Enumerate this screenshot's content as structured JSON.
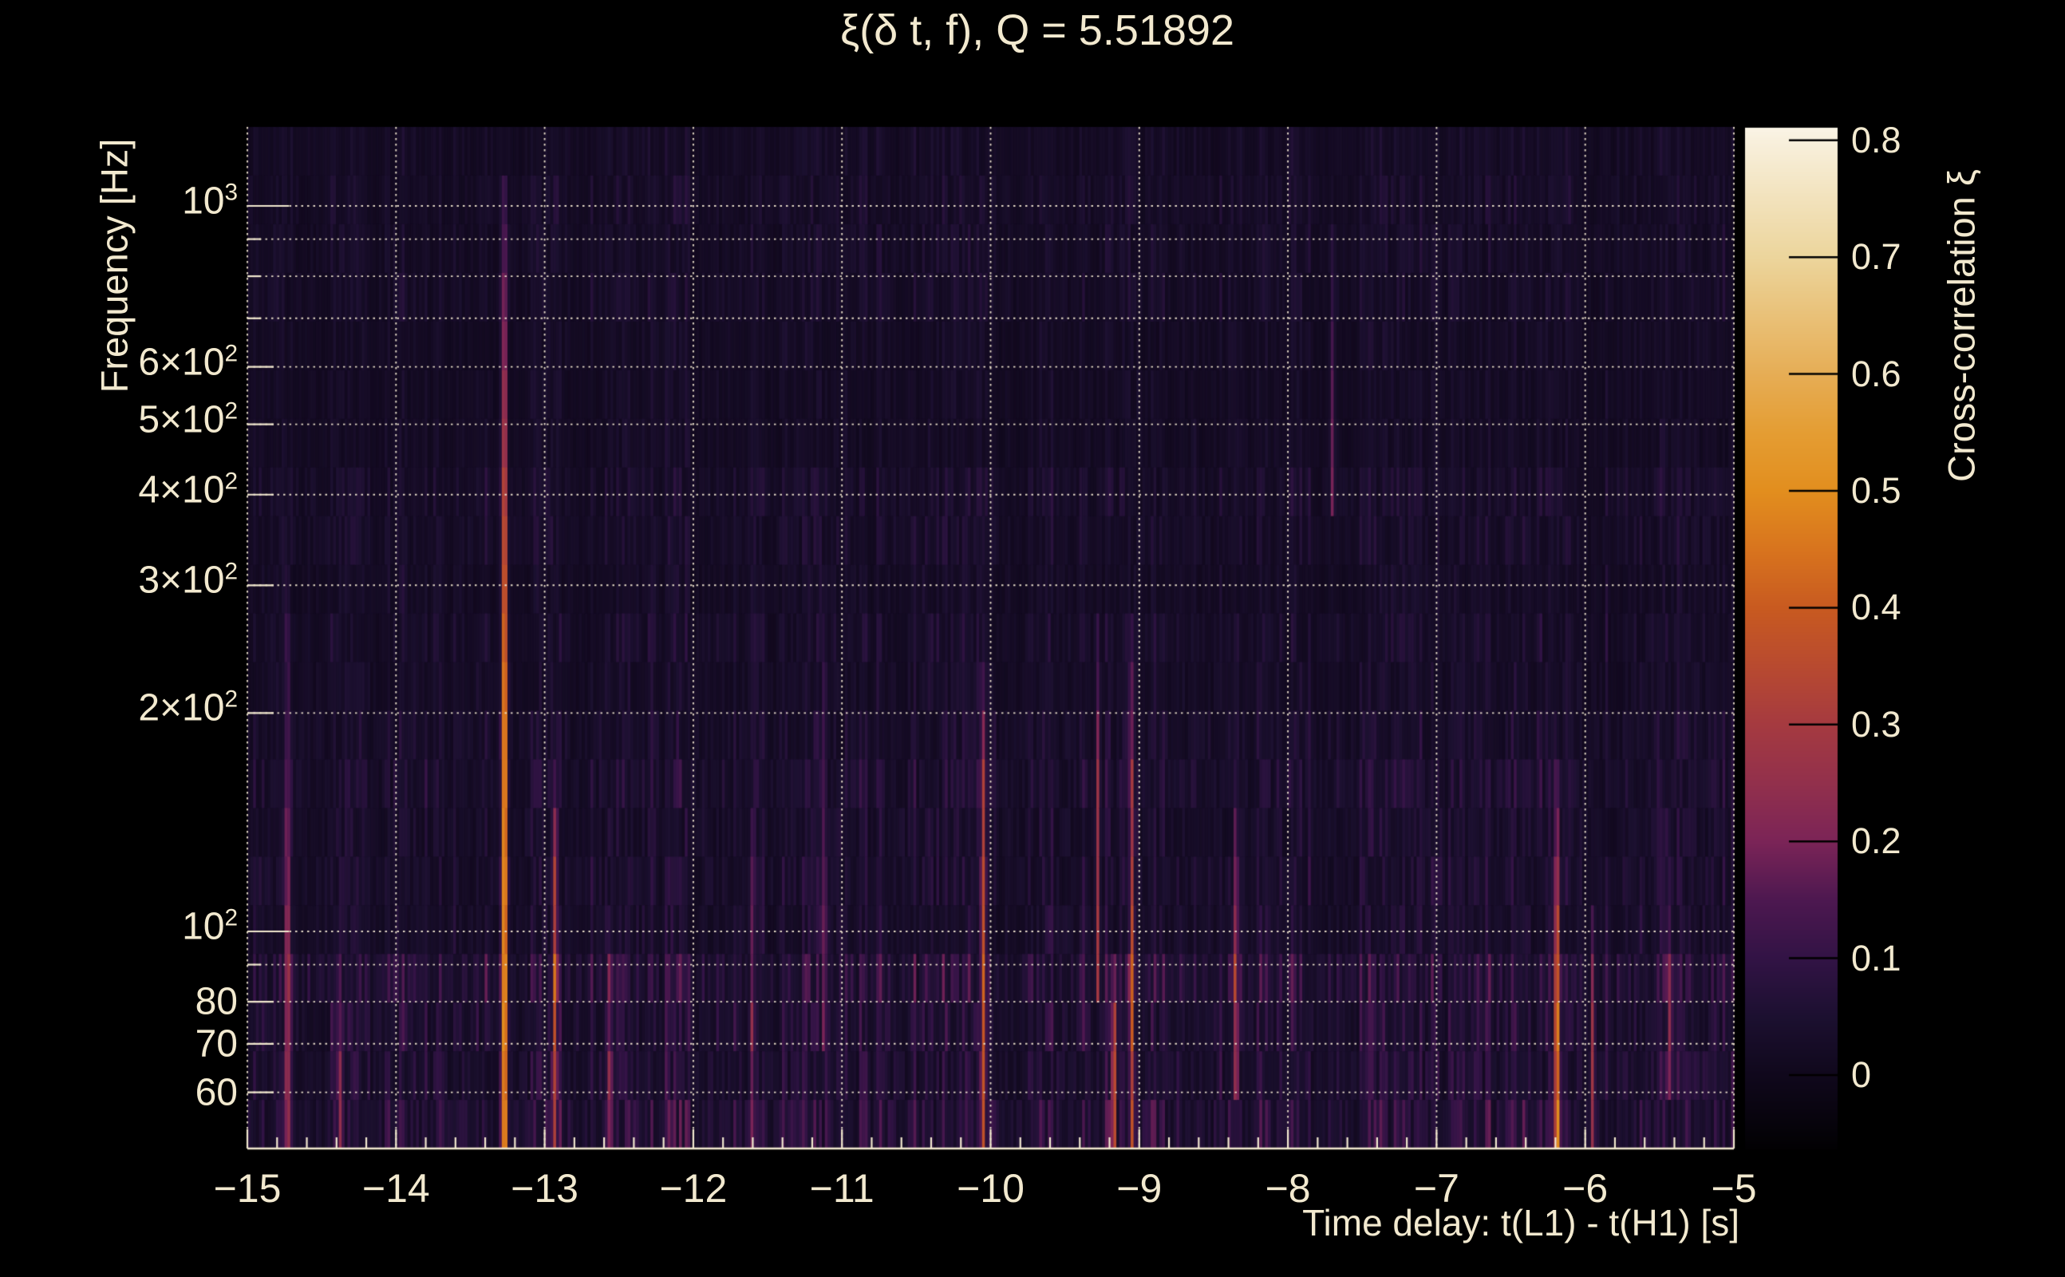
{
  "app": {
    "background_color": "#000000",
    "text_color": "#f2e9cf",
    "grid_color": "#efe5cf"
  },
  "chart_data": {
    "type": "heatmap",
    "title": "ξ(δ t, f), Q = 5.51892",
    "xlabel": "Time delay: t(L1) - t(H1) [s]",
    "ylabel": "Frequency [Hz]",
    "colorbar_label": "Cross-correlation ξ",
    "x_range": [
      -15,
      -5
    ],
    "x_minor_step": 0.2,
    "y_scale": "log",
    "y_range_hz": [
      50.2,
      1285
    ],
    "grid": true,
    "x_ticks": [
      {
        "v": -15,
        "label": "−15"
      },
      {
        "v": -14,
        "label": "−14"
      },
      {
        "v": -13,
        "label": "−13"
      },
      {
        "v": -12,
        "label": "−12"
      },
      {
        "v": -11,
        "label": "−11"
      },
      {
        "v": -10,
        "label": "−10"
      },
      {
        "v": -9,
        "label": "−9"
      },
      {
        "v": -8,
        "label": "−8"
      },
      {
        "v": -7,
        "label": "−7"
      },
      {
        "v": -6,
        "label": "−6"
      },
      {
        "v": -5,
        "label": "−5"
      }
    ],
    "y_ticks": [
      {
        "f": 1000,
        "base": "10",
        "sup": "3",
        "decade": true
      },
      {
        "f": 600,
        "base": "6×10",
        "sup": "2"
      },
      {
        "f": 500,
        "base": "5×10",
        "sup": "2"
      },
      {
        "f": 400,
        "base": "4×10",
        "sup": "2"
      },
      {
        "f": 300,
        "base": "3×10",
        "sup": "2"
      },
      {
        "f": 200,
        "base": "2×10",
        "sup": "2"
      },
      {
        "f": 100,
        "base": "10",
        "sup": "2",
        "decade": true
      },
      {
        "f": 80,
        "base": "80"
      },
      {
        "f": 70,
        "base": "70"
      },
      {
        "f": 60,
        "base": "60"
      }
    ],
    "y_gridlines_hz": [
      60,
      70,
      80,
      90,
      100,
      200,
      300,
      400,
      500,
      600,
      700,
      800,
      900,
      1000
    ],
    "colorbar": {
      "value_range": [
        -0.063,
        0.811
      ],
      "ticks": [
        {
          "v": 0.0,
          "label": "0"
        },
        {
          "v": 0.1,
          "label": "0.1"
        },
        {
          "v": 0.2,
          "label": "0.2"
        },
        {
          "v": 0.3,
          "label": "0.3"
        },
        {
          "v": 0.4,
          "label": "0.4"
        },
        {
          "v": 0.5,
          "label": "0.5"
        },
        {
          "v": 0.6,
          "label": "0.6"
        },
        {
          "v": 0.7,
          "label": "0.7"
        },
        {
          "v": 0.8,
          "label": "0.8"
        }
      ]
    },
    "colormap_stops": [
      [
        -0.07,
        "#000000"
      ],
      [
        0.0,
        "#10081c"
      ],
      [
        0.05,
        "#1c1030"
      ],
      [
        0.1,
        "#321345"
      ],
      [
        0.15,
        "#4d1850"
      ],
      [
        0.2,
        "#7b2457"
      ],
      [
        0.25,
        "#92304c"
      ],
      [
        0.3,
        "#a53a40"
      ],
      [
        0.35,
        "#b84a30"
      ],
      [
        0.4,
        "#c85a20"
      ],
      [
        0.45,
        "#d8741e"
      ],
      [
        0.5,
        "#e28e1e"
      ],
      [
        0.55,
        "#e49d33"
      ],
      [
        0.6,
        "#e6ad55"
      ],
      [
        0.65,
        "#e9c178"
      ],
      [
        0.7,
        "#ecd59c"
      ],
      [
        0.75,
        "#f2e2bc"
      ],
      [
        0.8,
        "#f8f0dd"
      ],
      [
        0.82,
        "#fcf8ee"
      ]
    ],
    "noise": {
      "seed": 1337,
      "columns": 520,
      "rows": 21,
      "base_level": 0.05,
      "band_gains": [
        [
          100,
          2.0
        ],
        [
          200,
          1.35
        ],
        [
          450,
          1.0
        ],
        [
          1300,
          0.88
        ]
      ]
    },
    "features": [
      {
        "t": -14.73,
        "f_lo": 50,
        "knee": 95,
        "f_hi": 300,
        "peak": 0.27,
        "sigma": 0.01
      },
      {
        "t": -14.38,
        "f_lo": 50,
        "knee": 70,
        "f_hi": 95,
        "peak": 0.17,
        "sigma": 0.009
      },
      {
        "t": -13.27,
        "f_lo": 50,
        "knee": 200,
        "f_hi": 1060,
        "peak": 0.58,
        "sigma": 0.012
      },
      {
        "t": -12.93,
        "f_lo": 50,
        "knee": 100,
        "f_hi": 170,
        "peak": 0.3,
        "sigma": 0.009
      },
      {
        "t": -12.56,
        "f_lo": 50,
        "knee": 70,
        "f_hi": 105,
        "peak": 0.2,
        "sigma": 0.009
      },
      {
        "t": -11.6,
        "f_lo": 50,
        "knee": 80,
        "f_hi": 140,
        "peak": 0.16,
        "sigma": 0.009
      },
      {
        "t": -11.12,
        "f_lo": 70,
        "knee": 130,
        "f_hi": 310,
        "peak": 0.17,
        "sigma": 0.009
      },
      {
        "t": -10.05,
        "f_lo": 50,
        "knee": 130,
        "f_hi": 230,
        "peak": 0.33,
        "sigma": 0.01
      },
      {
        "t": -9.28,
        "f_lo": 80,
        "knee": 150,
        "f_hi": 270,
        "peak": 0.25,
        "sigma": 0.009
      },
      {
        "t": -9.17,
        "f_lo": 50,
        "knee": 70,
        "f_hi": 95,
        "peak": 0.4,
        "sigma": 0.009
      },
      {
        "t": -9.05,
        "f_lo": 50,
        "knee": 120,
        "f_hi": 270,
        "peak": 0.3,
        "sigma": 0.01
      },
      {
        "t": -8.35,
        "f_lo": 58,
        "knee": 100,
        "f_hi": 170,
        "peak": 0.25,
        "sigma": 0.009
      },
      {
        "t": -7.7,
        "f_lo": 380,
        "knee": 550,
        "f_hi": 950,
        "peak": 0.16,
        "sigma": 0.009
      },
      {
        "t": -6.19,
        "f_lo": 50,
        "knee": 75,
        "f_hi": 170,
        "peak": 0.5,
        "sigma": 0.011
      },
      {
        "t": -5.95,
        "f_lo": 50,
        "knee": 75,
        "f_hi": 115,
        "peak": 0.24,
        "sigma": 0.009
      },
      {
        "t": -5.43,
        "f_lo": 55,
        "knee": 80,
        "f_hi": 125,
        "peak": 0.19,
        "sigma": 0.009
      }
    ]
  }
}
